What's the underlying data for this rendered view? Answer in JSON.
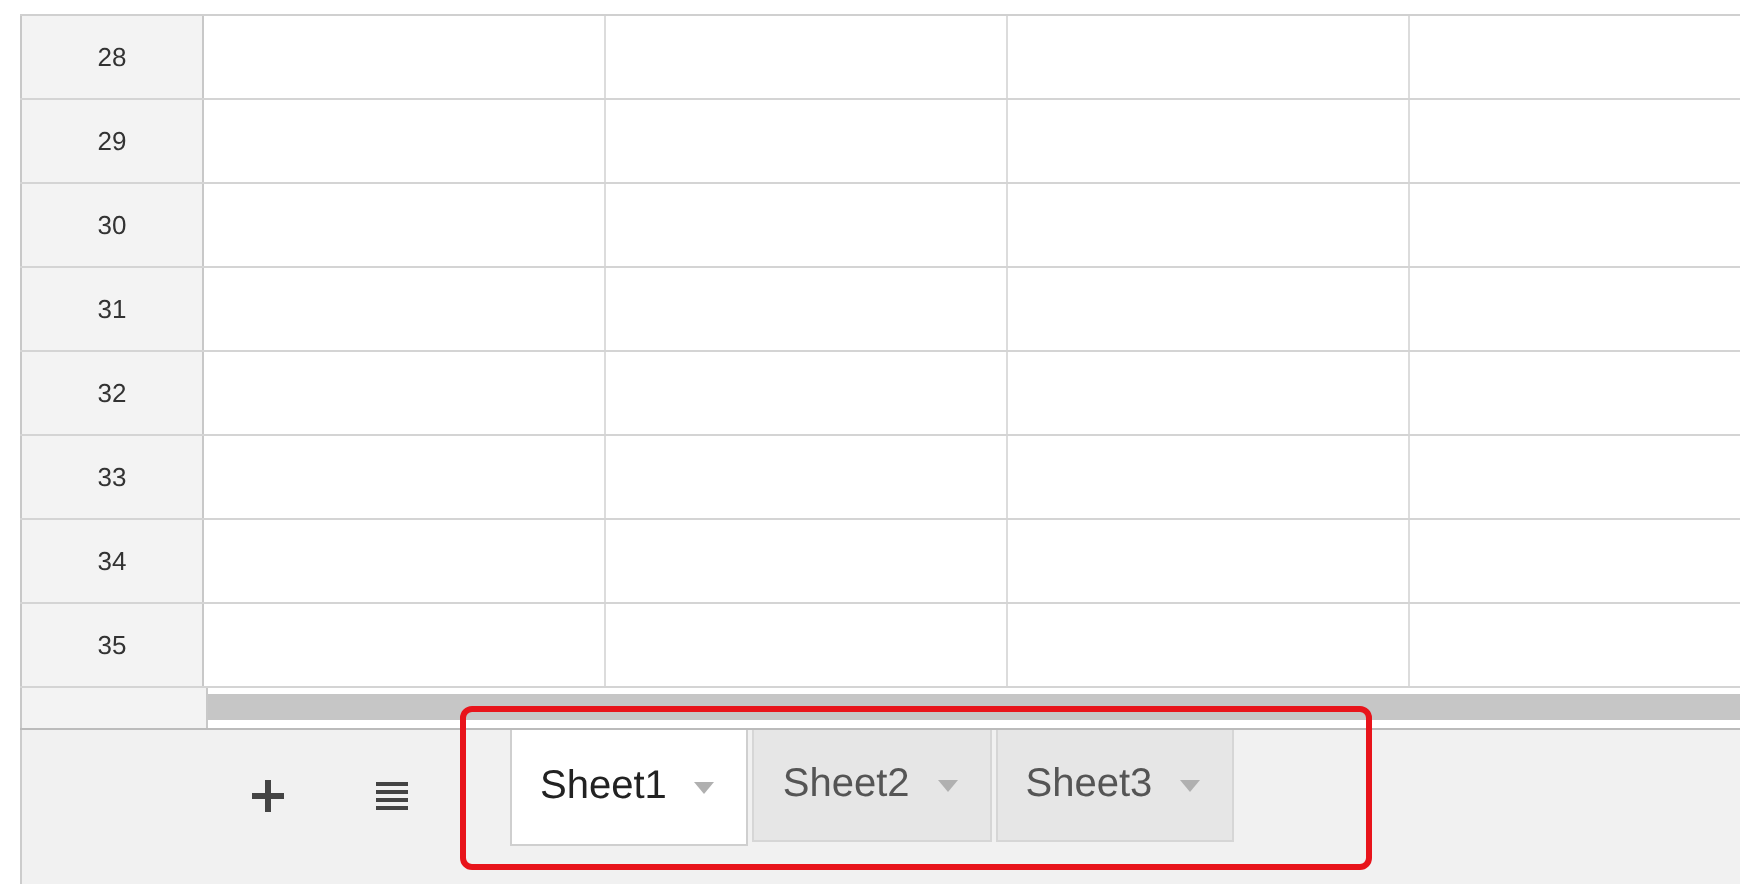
{
  "grid": {
    "rows": [
      "28",
      "29",
      "30",
      "31",
      "32",
      "33",
      "34",
      "35"
    ]
  },
  "sheet_bar": {
    "tabs": [
      {
        "label": "Sheet1",
        "selected": true
      },
      {
        "label": "Sheet2",
        "selected": false
      },
      {
        "label": "Sheet3",
        "selected": false
      }
    ]
  }
}
